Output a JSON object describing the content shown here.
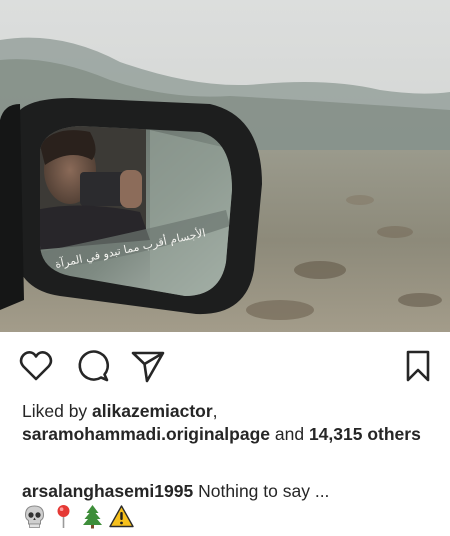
{
  "post": {
    "image_alt": "Photo of a car side mirror reflecting a person taking a photo",
    "mirror_text": "الأجسام أقرب مما تبدو في المرآة"
  },
  "actions": {
    "like_icon": "heart-icon",
    "comment_icon": "comment-icon",
    "share_icon": "paper-plane-icon",
    "save_icon": "bookmark-icon"
  },
  "likes": {
    "prefix": "Liked by ",
    "user1": "alikazemiactor",
    "sep": ",",
    "user2": "saramohammadi.originalpage",
    "and": " and ",
    "count": "14,315",
    "suffix": "others"
  },
  "caption": {
    "username": "arsalanghasemi1995",
    "text": " Nothing to say ..."
  },
  "emojis": [
    "skull",
    "round-pushpin",
    "evergreen-tree",
    "warning-sign"
  ],
  "colors": {
    "text": "#262626",
    "background": "#ffffff"
  }
}
